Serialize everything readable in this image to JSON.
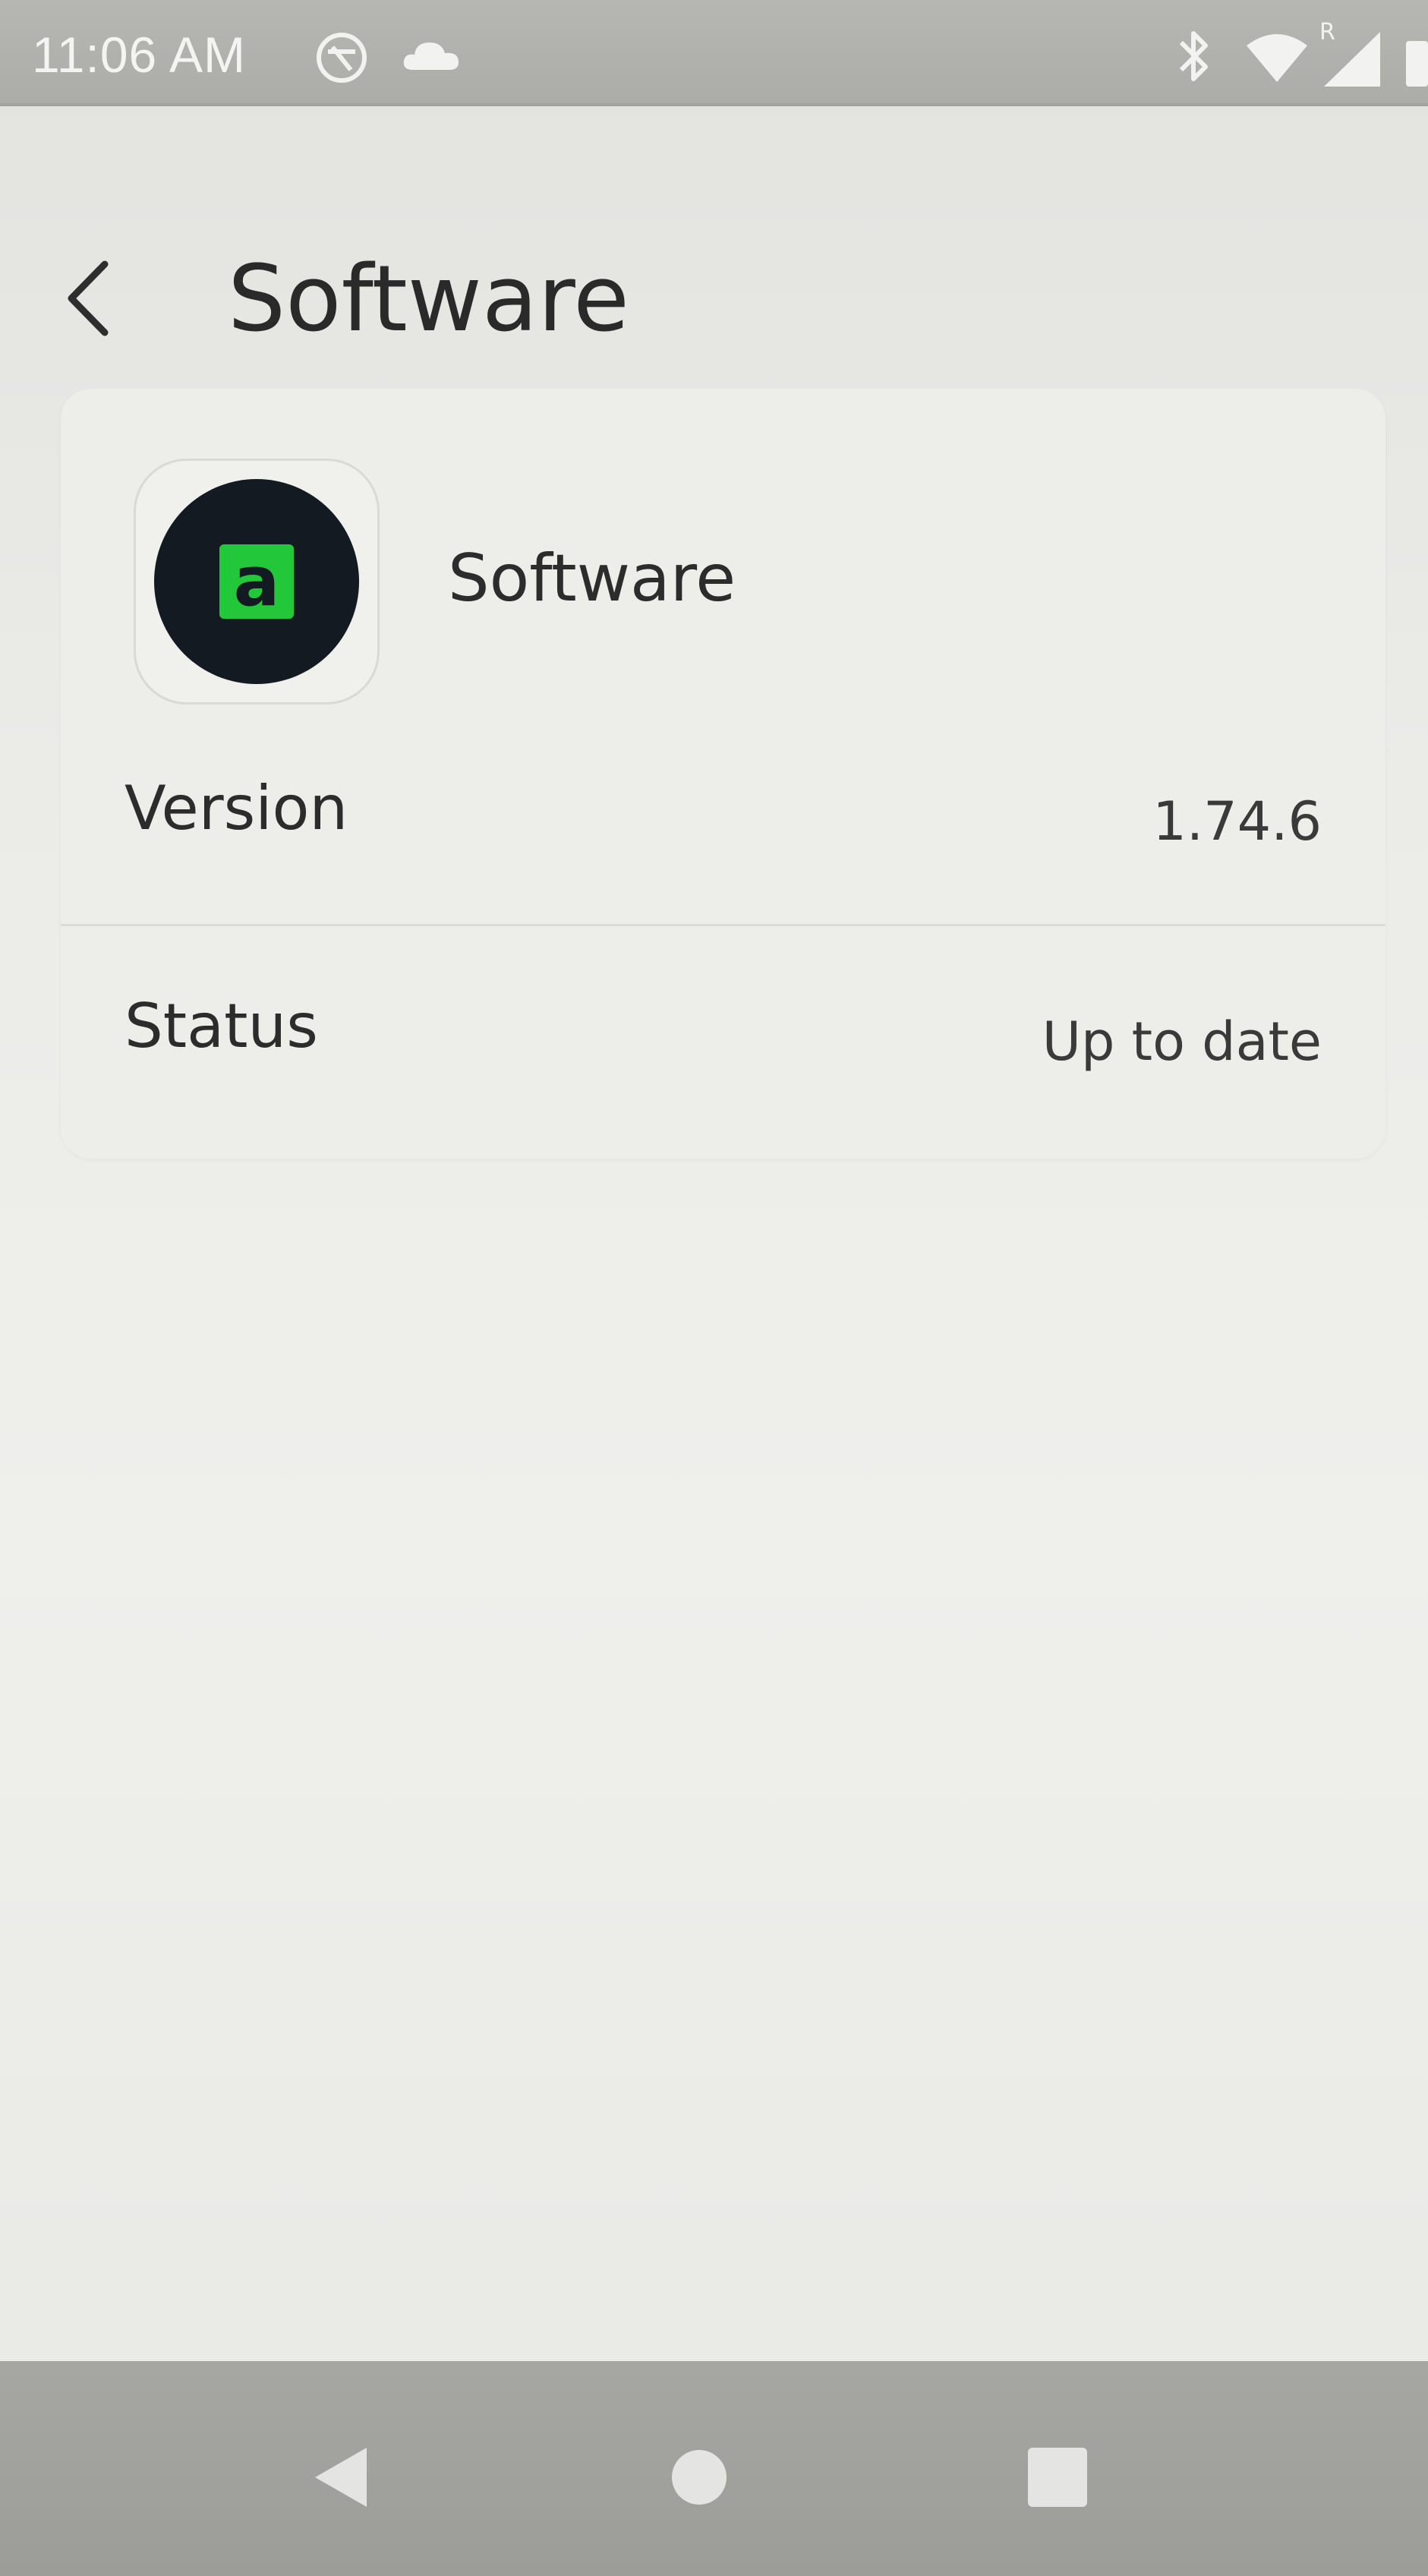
{
  "status_bar": {
    "time": "11:06 AM",
    "icons": [
      "vpn-shield-icon",
      "cloud-icon",
      "bluetooth-icon",
      "wifi-icon",
      "signal-roaming-icon",
      "battery-icon"
    ],
    "roaming_label": "R"
  },
  "header": {
    "back_icon": "chevron-left-icon",
    "title": "Software"
  },
  "software_card": {
    "app_icon": "app-logo-icon",
    "app_icon_letter": "a",
    "app_name": "Software",
    "rows": [
      {
        "label": "Version",
        "value": "1.74.6"
      },
      {
        "label": "Status",
        "value": "Up to date"
      }
    ]
  },
  "nav_bar": {
    "buttons": [
      "nav-back-icon",
      "nav-home-icon",
      "nav-recents-icon"
    ]
  },
  "colors": {
    "status_bar_bg": "#acaca8",
    "screen_bg": "#ebebe8",
    "card_bg": "#ededea",
    "app_icon_bg": "#141a22",
    "app_icon_accent": "#22c83a",
    "nav_bar_bg": "#a2a29e"
  }
}
